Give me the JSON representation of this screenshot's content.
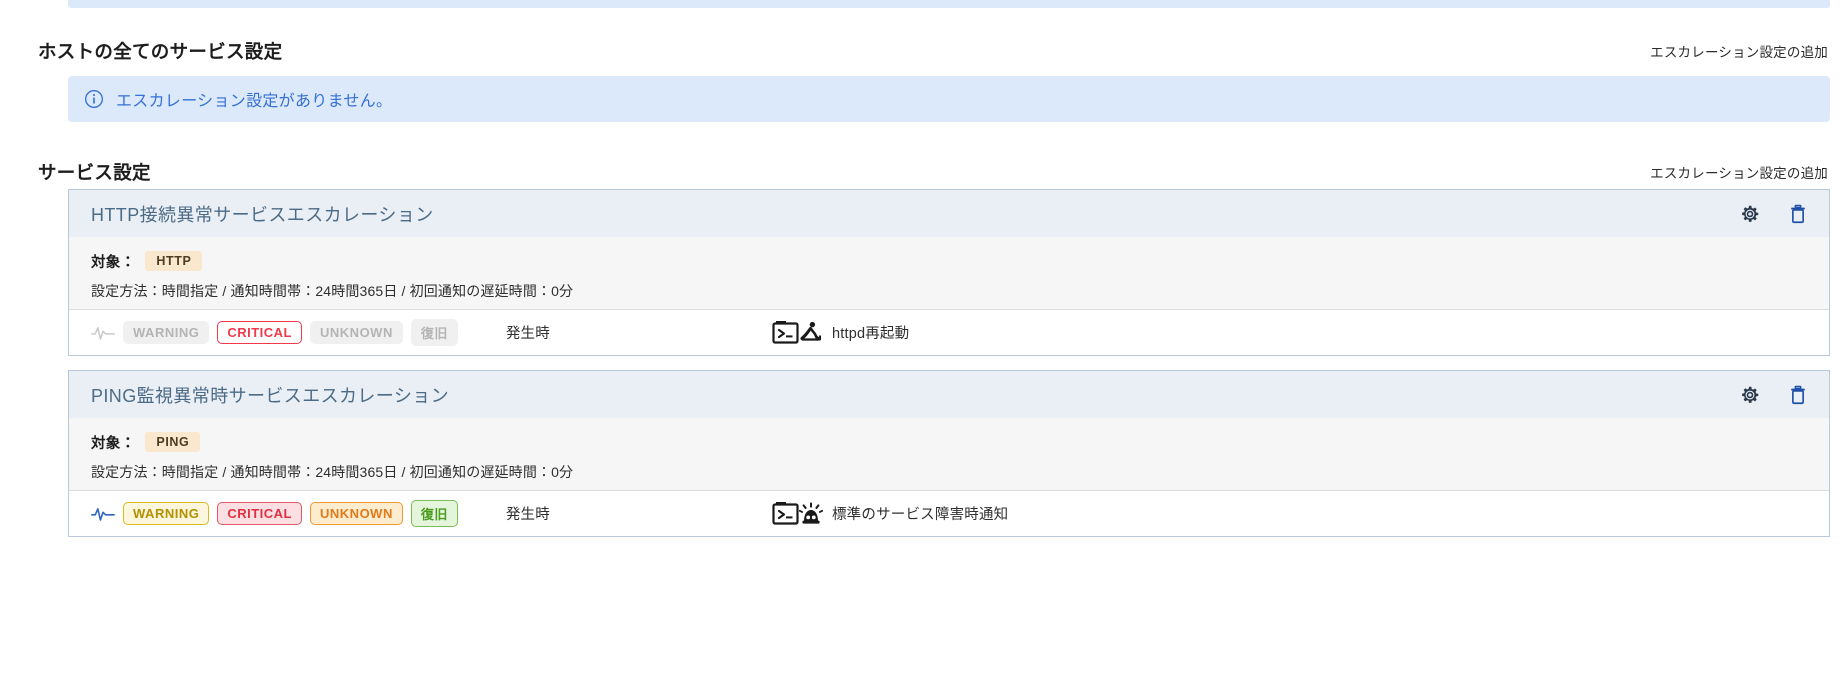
{
  "top_strip": {
    "name": "cut-off-alert-strip"
  },
  "host_section": {
    "title": "ホストの全てのサービス設定",
    "add_link": "エスカレーション設定の追加",
    "empty_alert": {
      "icon": "info-circle-icon",
      "text": "エスカレーション設定がありません。"
    }
  },
  "service_section": {
    "title": "サービス設定",
    "add_link": "エスカレーション設定の追加",
    "cards": [
      {
        "title": "HTTP接続異常サービスエスカレーション",
        "gear_icon": "gear-icon",
        "trash_icon": "trash-icon",
        "target_label": "対象：",
        "target_badge": "HTTP",
        "settings_line": "設定方法：時間指定 / 通知時間帯：24時間365日 / 初回通知の遅延時間：0分",
        "pulse_icon": "pulse-icon",
        "statuses": [
          {
            "label": "WARNING",
            "state": "off"
          },
          {
            "label": "CRITICAL",
            "state": "critical-solo"
          },
          {
            "label": "UNKNOWN",
            "state": "off"
          },
          {
            "label": "復旧",
            "state": "off"
          }
        ],
        "timing": "発生時",
        "action_icon": "terminal-escalate-icon",
        "action_text": "httpd再起動"
      },
      {
        "title": "PING監視異常時サービスエスカレーション",
        "gear_icon": "gear-icon",
        "trash_icon": "trash-icon",
        "target_label": "対象：",
        "target_badge": "PING",
        "settings_line": "設定方法：時間指定 / 通知時間帯：24時間365日 / 初回通知の遅延時間：0分",
        "pulse_icon": "pulse-icon",
        "statuses": [
          {
            "label": "WARNING",
            "state": "warning"
          },
          {
            "label": "CRITICAL",
            "state": "critical"
          },
          {
            "label": "UNKNOWN",
            "state": "unknown"
          },
          {
            "label": "復旧",
            "state": "recover"
          }
        ],
        "timing": "発生時",
        "action_icon": "terminal-siren-icon",
        "action_text": "標準のサービス障害時通知"
      }
    ]
  },
  "colors": {
    "alert_bg": "#dbe9fb",
    "alert_text": "#3570d4",
    "card_header_bg": "#eaeff5",
    "card_title": "#4c6b86",
    "card_border": "#b9c8da",
    "target_badge_bg": "#fae8ce",
    "trash_blue": "#1e4fa8",
    "gear_dark": "#2b3a4a",
    "pulse_blue": "#2e68c4"
  }
}
